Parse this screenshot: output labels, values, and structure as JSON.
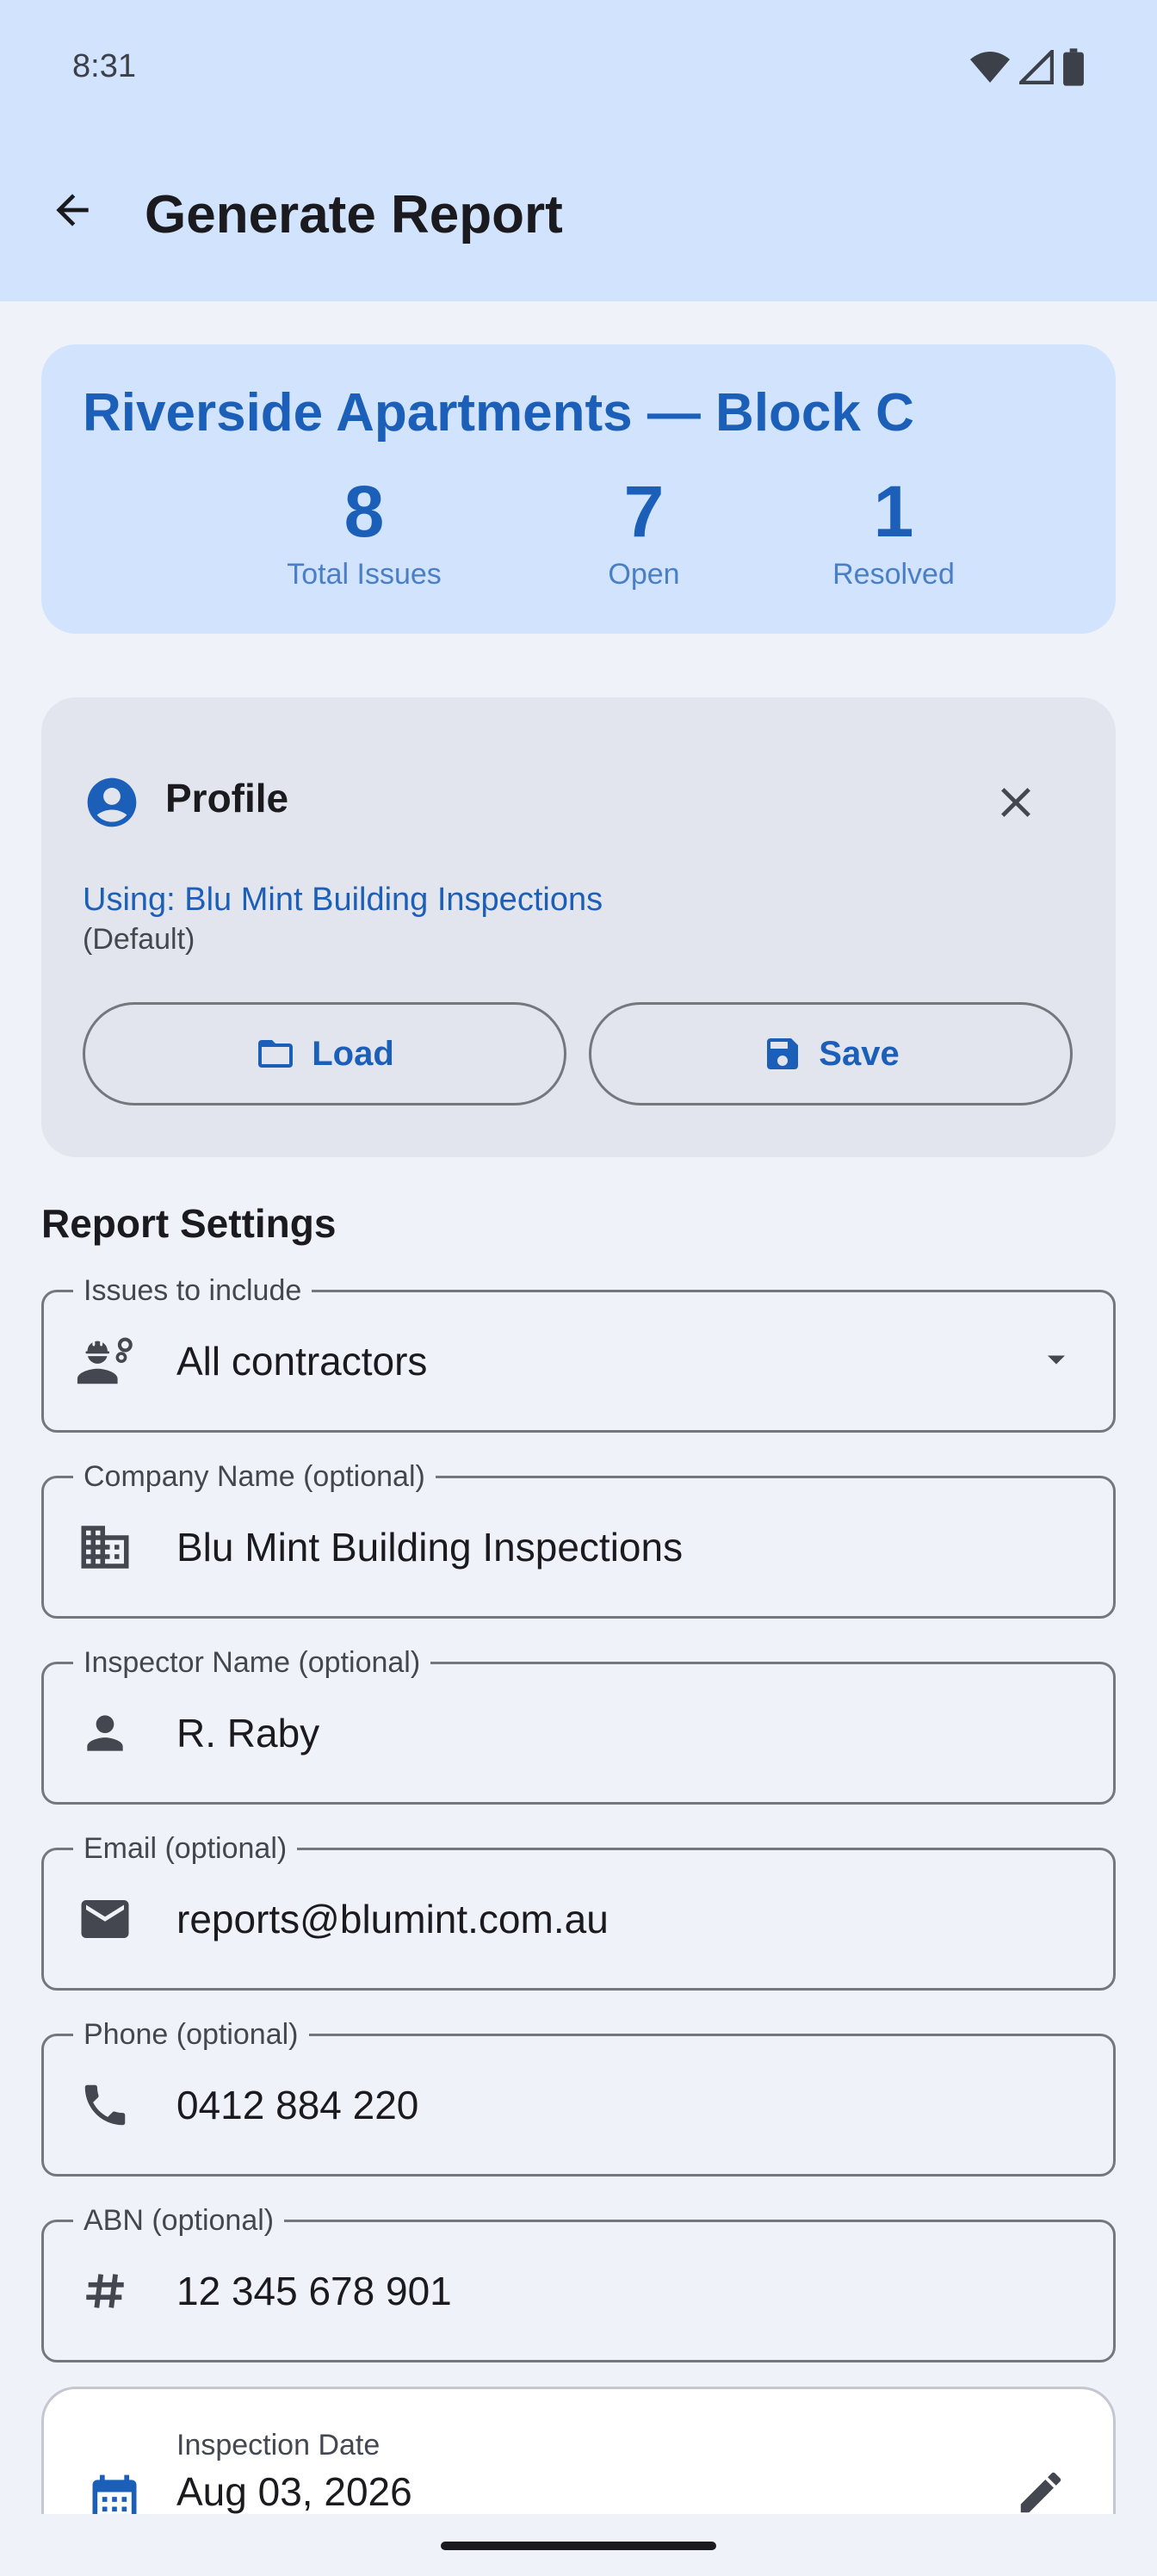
{
  "status_bar": {
    "time": "8:31"
  },
  "app_bar": {
    "title": "Generate Report"
  },
  "summary": {
    "project_name": "Riverside Apartments — Block C",
    "stats": [
      {
        "value": "8",
        "label": "Total Issues"
      },
      {
        "value": "7",
        "label": "Open"
      },
      {
        "value": "1",
        "label": "Resolved"
      }
    ]
  },
  "profile": {
    "title": "Profile",
    "using_text": "Using: Blu Mint Building Inspections",
    "default_text": "(Default)",
    "load_label": "Load",
    "save_label": "Save"
  },
  "report_settings": {
    "title": "Report Settings",
    "fields": [
      {
        "label": "Issues to include",
        "value": "All contractors",
        "icon": "engineer-gear-icon"
      },
      {
        "label": "Company Name (optional)",
        "value": "Blu Mint Building Inspections",
        "icon": "building-icon"
      },
      {
        "label": "Inspector Name (optional)",
        "value": "R. Raby",
        "icon": "person-icon"
      },
      {
        "label": "Email (optional)",
        "value": "reports@blumint.com.au",
        "icon": "mail-icon"
      },
      {
        "label": "Phone (optional)",
        "value": "0412 884 220",
        "icon": "phone-icon"
      },
      {
        "label": "ABN (optional)",
        "value": "12 345 678 901",
        "icon": "hash-icon"
      }
    ],
    "inspection_date": {
      "label": "Inspection Date",
      "value": "Aug 03, 2026",
      "icon": "calendar-icon"
    }
  },
  "colors": {
    "accent": "#1b5fb9",
    "header_bg": "#d1e3fd",
    "background": "#f0f2f9",
    "card_bg": "#e3e5ee"
  }
}
